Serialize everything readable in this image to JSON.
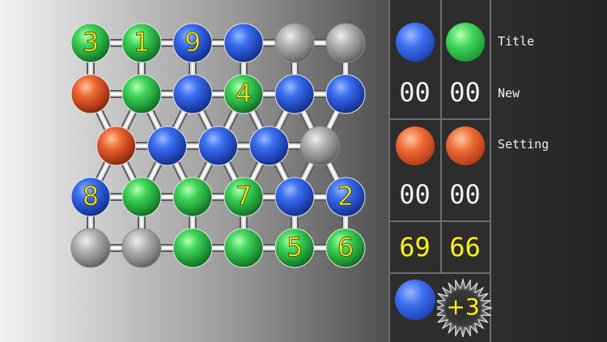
{
  "board": {
    "rows": [
      [
        {
          "c": "green",
          "n": "3"
        },
        {
          "c": "green",
          "n": "1"
        },
        {
          "c": "blue",
          "n": "9"
        },
        {
          "c": "blue",
          "n": ""
        },
        {
          "c": "gray",
          "n": ""
        },
        {
          "c": "gray",
          "n": ""
        }
      ],
      [
        {
          "c": "orange",
          "n": ""
        },
        {
          "c": "green",
          "n": ""
        },
        {
          "c": "blue",
          "n": ""
        },
        {
          "c": "green",
          "n": "4"
        },
        {
          "c": "blue",
          "n": ""
        },
        {
          "c": "blue",
          "n": ""
        }
      ],
      [
        {
          "c": "orange",
          "n": ""
        },
        {
          "c": "blue",
          "n": ""
        },
        {
          "c": "blue",
          "n": ""
        },
        {
          "c": "blue",
          "n": ""
        },
        {
          "c": "gray",
          "n": ""
        }
      ],
      [
        {
          "c": "blue",
          "n": "8"
        },
        {
          "c": "green",
          "n": ""
        },
        {
          "c": "green",
          "n": ""
        },
        {
          "c": "green",
          "n": "7"
        },
        {
          "c": "blue",
          "n": ""
        },
        {
          "c": "blue",
          "n": "2"
        }
      ],
      [
        {
          "c": "gray",
          "n": ""
        },
        {
          "c": "gray",
          "n": ""
        },
        {
          "c": "green",
          "n": ""
        },
        {
          "c": "green",
          "n": ""
        },
        {
          "c": "green",
          "n": "5"
        },
        {
          "c": "green",
          "n": "6"
        }
      ]
    ]
  },
  "panel": {
    "counters_top": [
      "00",
      "00"
    ],
    "counters_bottom": [
      "00",
      "00"
    ],
    "totals": [
      "69",
      "66"
    ],
    "bonus_label": "+3"
  },
  "menu": {
    "title": "Title",
    "new": "New",
    "setting": "Setting"
  },
  "colors": {
    "blue": "#3c6ff0",
    "green": "#3fd45a",
    "orange": "#ee6a35",
    "gray": "#a0a0a0",
    "number_yellow": "#ffef1a",
    "panel_bg": "#2d2d2d"
  }
}
